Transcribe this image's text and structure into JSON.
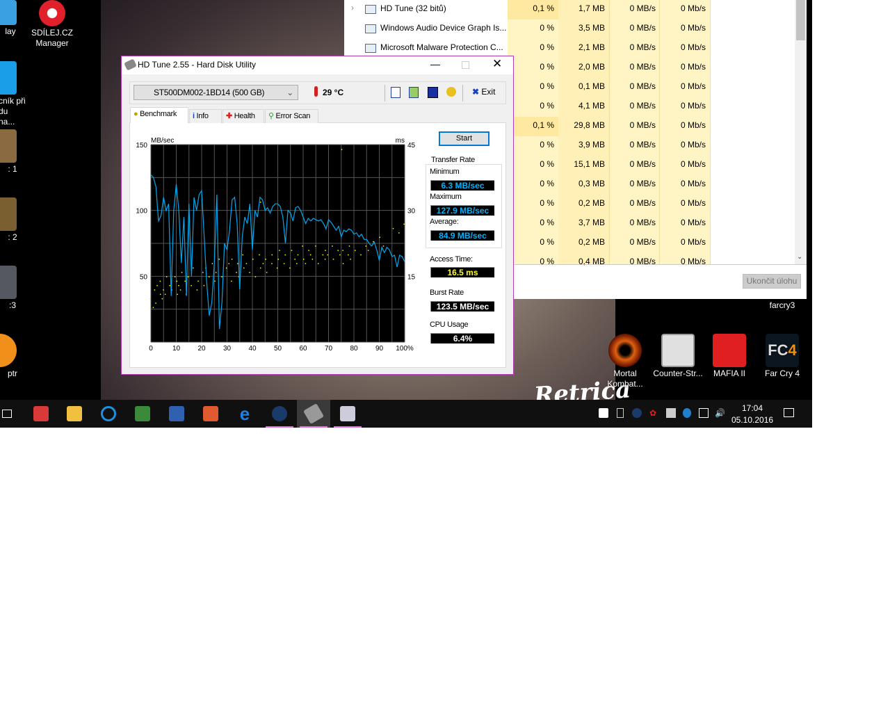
{
  "desktop": {
    "left_icons": [
      {
        "label": "lay"
      },
      {
        "label": "SDÍLEJ.CZ Manager"
      },
      {
        "label": "cník při du na..."
      },
      {
        "label": ": 1"
      },
      {
        "label": ": 2"
      },
      {
        "label": ":3"
      },
      {
        "label": "ptr"
      }
    ],
    "right_icons": [
      {
        "label": "farcry3"
      },
      {
        "label": "Mortal Kombat..."
      },
      {
        "label": "Counter-Str..."
      },
      {
        "label": "MAFIA II"
      },
      {
        "label": "Far Cry 4"
      }
    ],
    "watermark": "Retrica"
  },
  "task_manager": {
    "rows": [
      {
        "name": "HD Tune (32 bitů)",
        "cpu": "0,1 %",
        "mem": "1,7 MB",
        "disk": "0 MB/s",
        "net": "0 Mb/s",
        "expand": true,
        "hot": true
      },
      {
        "name": "Windows Audio Device Graph Is...",
        "cpu": "0 %",
        "mem": "3,5 MB",
        "disk": "0 MB/s",
        "net": "0 Mb/s"
      },
      {
        "name": "Microsoft Malware Protection C...",
        "cpu": "0 %",
        "mem": "2,1 MB",
        "disk": "0 MB/s",
        "net": "0 Mb/s"
      },
      {
        "name": "",
        "cpu": "0 %",
        "mem": "2,0 MB",
        "disk": "0 MB/s",
        "net": "0 Mb/s"
      },
      {
        "name": "",
        "cpu": "0 %",
        "mem": "0,1 MB",
        "disk": "0 MB/s",
        "net": "0 Mb/s"
      },
      {
        "name": "",
        "cpu": "0 %",
        "mem": "4,1 MB",
        "disk": "0 MB/s",
        "net": "0 Mb/s"
      },
      {
        "name": "",
        "cpu": "0,1 %",
        "mem": "29,8 MB",
        "disk": "0 MB/s",
        "net": "0 Mb/s",
        "hot": true
      },
      {
        "name": "",
        "cpu": "0 %",
        "mem": "3,9 MB",
        "disk": "0 MB/s",
        "net": "0 Mb/s"
      },
      {
        "name": "",
        "cpu": "0 %",
        "mem": "15,1 MB",
        "disk": "0 MB/s",
        "net": "0 Mb/s"
      },
      {
        "name": "",
        "cpu": "0 %",
        "mem": "0,3 MB",
        "disk": "0 MB/s",
        "net": "0 Mb/s"
      },
      {
        "name": "",
        "cpu": "0 %",
        "mem": "0,2 MB",
        "disk": "0 MB/s",
        "net": "0 Mb/s"
      },
      {
        "name": "",
        "cpu": "0 %",
        "mem": "3,7 MB",
        "disk": "0 MB/s",
        "net": "0 Mb/s"
      },
      {
        "name": "",
        "cpu": "0 %",
        "mem": "0,2 MB",
        "disk": "0 MB/s",
        "net": "0 Mb/s"
      },
      {
        "name": "",
        "cpu": "0 %",
        "mem": "0,4 MB",
        "disk": "0 MB/s",
        "net": "0 Mb/s"
      }
    ],
    "end_task_label": "Ukončit úlohu"
  },
  "hdtune": {
    "title": "HD Tune 2.55 - Hard Disk Utility",
    "drive": "ST500DM002-1BD14 (500 GB)",
    "temperature": "29 °C",
    "exit_label": "Exit",
    "tabs": [
      "Benchmark",
      "Info",
      "Health",
      "Error Scan"
    ],
    "start_label": "Start",
    "transfer_rate_label": "Transfer Rate",
    "minimum_label": "Minimum",
    "minimum": "6.3 MB/sec",
    "maximum_label": "Maximum",
    "maximum": "127.9 MB/sec",
    "average_label": "Average:",
    "average": "84.9 MB/sec",
    "access_time_label": "Access Time:",
    "access_time": "16.5 ms",
    "burst_rate_label": "Burst Rate",
    "burst_rate": "123.5 MB/sec",
    "cpu_usage_label": "CPU Usage",
    "cpu_usage": "6.4%"
  },
  "chart_data": {
    "type": "line",
    "ylabel": "MB/sec",
    "y2label": "ms",
    "ylim": [
      0,
      150
    ],
    "y2lim": [
      0,
      45
    ],
    "xlim": [
      0,
      100
    ],
    "xticks": [
      "0",
      "10",
      "20",
      "30",
      "40",
      "50",
      "60",
      "70",
      "80",
      "90",
      "100%"
    ],
    "yticks": [
      "150",
      "100",
      "50"
    ],
    "y2ticks": [
      "45",
      "30",
      "15"
    ],
    "grid": true,
    "series": [
      {
        "name": "Transfer rate (MB/sec)",
        "color": "#00a8f0",
        "x": [
          0,
          1,
          2,
          3,
          4,
          5,
          6,
          7,
          8,
          9,
          10,
          11,
          12,
          13,
          14,
          15,
          16,
          17,
          18,
          19,
          20,
          21,
          22,
          23,
          24,
          25,
          26,
          27,
          28,
          29,
          30,
          31,
          32,
          33,
          34,
          35,
          36,
          37,
          38,
          39,
          40,
          41,
          42,
          43,
          44,
          45,
          46,
          47,
          48,
          49,
          50,
          51,
          52,
          53,
          54,
          55,
          56,
          57,
          58,
          59,
          60,
          61,
          62,
          63,
          64,
          65,
          66,
          67,
          68,
          69,
          70,
          71,
          72,
          73,
          74,
          75,
          76,
          77,
          78,
          79,
          80,
          81,
          82,
          83,
          84,
          85,
          86,
          87,
          88,
          89,
          90,
          91,
          92,
          93,
          94,
          95,
          96,
          97,
          98,
          99,
          100
        ],
        "values": [
          127,
          125,
          118,
          92,
          96,
          110,
          100,
          105,
          35,
          100,
          120,
          100,
          60,
          95,
          35,
          105,
          50,
          110,
          100,
          112,
          115,
          80,
          45,
          20,
          30,
          60,
          112,
          10,
          30,
          75,
          70,
          85,
          108,
          110,
          90,
          40,
          80,
          95,
          90,
          105,
          70,
          100,
          95,
          110,
          108,
          100,
          102,
          98,
          103,
          105,
          105,
          103,
          95,
          75,
          100,
          98,
          92,
          102,
          103,
          100,
          95,
          90,
          94,
          92,
          94,
          93,
          92,
          93,
          90,
          86,
          93,
          91,
          88,
          85,
          88,
          80,
          85,
          84,
          86,
          85,
          82,
          83,
          80,
          82,
          78,
          78,
          75,
          73,
          76,
          70,
          62,
          72,
          68,
          72,
          70,
          65,
          66,
          57,
          66,
          65,
          61
        ]
      },
      {
        "name": "Access time (ms)",
        "color": "#ffff00",
        "axis": "right",
        "points": [
          [
            0,
            10
          ],
          [
            1,
            12
          ],
          [
            1,
            8
          ],
          [
            2,
            13
          ],
          [
            2,
            9
          ],
          [
            3,
            11
          ],
          [
            4,
            14
          ],
          [
            4,
            10
          ],
          [
            5,
            12
          ],
          [
            6,
            15
          ],
          [
            6,
            11
          ],
          [
            7,
            13
          ],
          [
            8,
            12
          ],
          [
            9,
            15
          ],
          [
            10,
            11
          ],
          [
            10,
            14
          ],
          [
            11,
            13
          ],
          [
            12,
            16
          ],
          [
            12,
            12
          ],
          [
            13,
            14
          ],
          [
            14,
            11
          ],
          [
            15,
            15
          ],
          [
            16,
            13
          ],
          [
            17,
            17
          ],
          [
            18,
            12
          ],
          [
            19,
            14
          ],
          [
            20,
            16
          ],
          [
            21,
            13
          ],
          [
            22,
            17
          ],
          [
            23,
            15
          ],
          [
            24,
            18
          ],
          [
            25,
            14
          ],
          [
            26,
            16
          ],
          [
            27,
            19
          ],
          [
            28,
            15
          ],
          [
            29,
            17
          ],
          [
            30,
            18
          ],
          [
            31,
            14
          ],
          [
            32,
            19
          ],
          [
            33,
            16
          ],
          [
            34,
            18
          ],
          [
            35,
            15
          ],
          [
            36,
            20
          ],
          [
            37,
            17
          ],
          [
            38,
            18
          ],
          [
            39,
            16
          ],
          [
            40,
            19
          ],
          [
            41,
            15
          ],
          [
            42,
            20
          ],
          [
            43,
            17
          ],
          [
            44,
            18
          ],
          [
            45,
            19
          ],
          [
            46,
            16
          ],
          [
            47,
            20
          ],
          [
            48,
            18
          ],
          [
            49,
            17
          ],
          [
            50,
            19
          ],
          [
            51,
            21
          ],
          [
            52,
            18
          ],
          [
            53,
            20
          ],
          [
            54,
            17
          ],
          [
            55,
            21
          ],
          [
            56,
            19
          ],
          [
            57,
            18
          ],
          [
            58,
            20
          ],
          [
            59,
            22
          ],
          [
            60,
            19
          ],
          [
            61,
            18
          ],
          [
            62,
            21
          ],
          [
            63,
            20
          ],
          [
            64,
            19
          ],
          [
            65,
            22
          ],
          [
            66,
            18
          ],
          [
            67,
            20
          ],
          [
            68,
            21
          ],
          [
            69,
            19
          ],
          [
            70,
            20
          ],
          [
            71,
            22
          ],
          [
            72,
            19
          ],
          [
            73,
            21
          ],
          [
            74,
            20
          ],
          [
            75,
            18
          ],
          [
            76,
            21
          ],
          [
            77,
            20
          ],
          [
            78,
            22
          ],
          [
            79,
            19
          ],
          [
            80,
            21
          ],
          [
            82,
            20
          ],
          [
            84,
            22
          ],
          [
            86,
            21
          ],
          [
            88,
            23
          ],
          [
            90,
            24
          ],
          [
            92,
            22
          ],
          [
            95,
            26
          ],
          [
            97,
            25
          ],
          [
            99,
            27
          ],
          [
            75,
            44
          ],
          [
            43,
            32
          ]
        ]
      }
    ]
  },
  "taskbar": {
    "time": "17:04",
    "date": "05.10.2016",
    "apps": [
      "task-view",
      "red-app",
      "file-explorer",
      "ccleaner",
      "excel",
      "word",
      "powerpoint",
      "edge",
      "steam",
      "hd-tune",
      "resource-monitor"
    ]
  }
}
